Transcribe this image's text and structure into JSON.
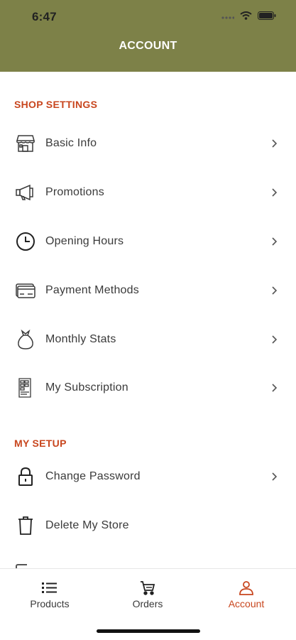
{
  "status_bar": {
    "time": "6:47"
  },
  "header": {
    "title": "ACCOUNT"
  },
  "sections": {
    "shop_settings": {
      "title": "SHOP SETTINGS",
      "items": [
        {
          "label": "Basic Info",
          "icon": "store-icon"
        },
        {
          "label": "Promotions",
          "icon": "megaphone-icon"
        },
        {
          "label": "Opening Hours",
          "icon": "clock-icon"
        },
        {
          "label": "Payment Methods",
          "icon": "credit-card-icon"
        },
        {
          "label": "Monthly Stats",
          "icon": "money-bag-icon"
        },
        {
          "label": "My Subscription",
          "icon": "receipt-icon"
        }
      ]
    },
    "my_setup": {
      "title": "MY SETUP",
      "items": [
        {
          "label": "Change Password",
          "icon": "lock-icon"
        },
        {
          "label": "Delete My Store",
          "icon": "trash-icon"
        }
      ]
    }
  },
  "tabs": [
    {
      "label": "Products",
      "icon": "list-icon",
      "active": false
    },
    {
      "label": "Orders",
      "icon": "cart-icon",
      "active": false
    },
    {
      "label": "Account",
      "icon": "user-icon",
      "active": true
    }
  ],
  "colors": {
    "header_bg": "#7d8148",
    "accent": "#c8461e"
  }
}
